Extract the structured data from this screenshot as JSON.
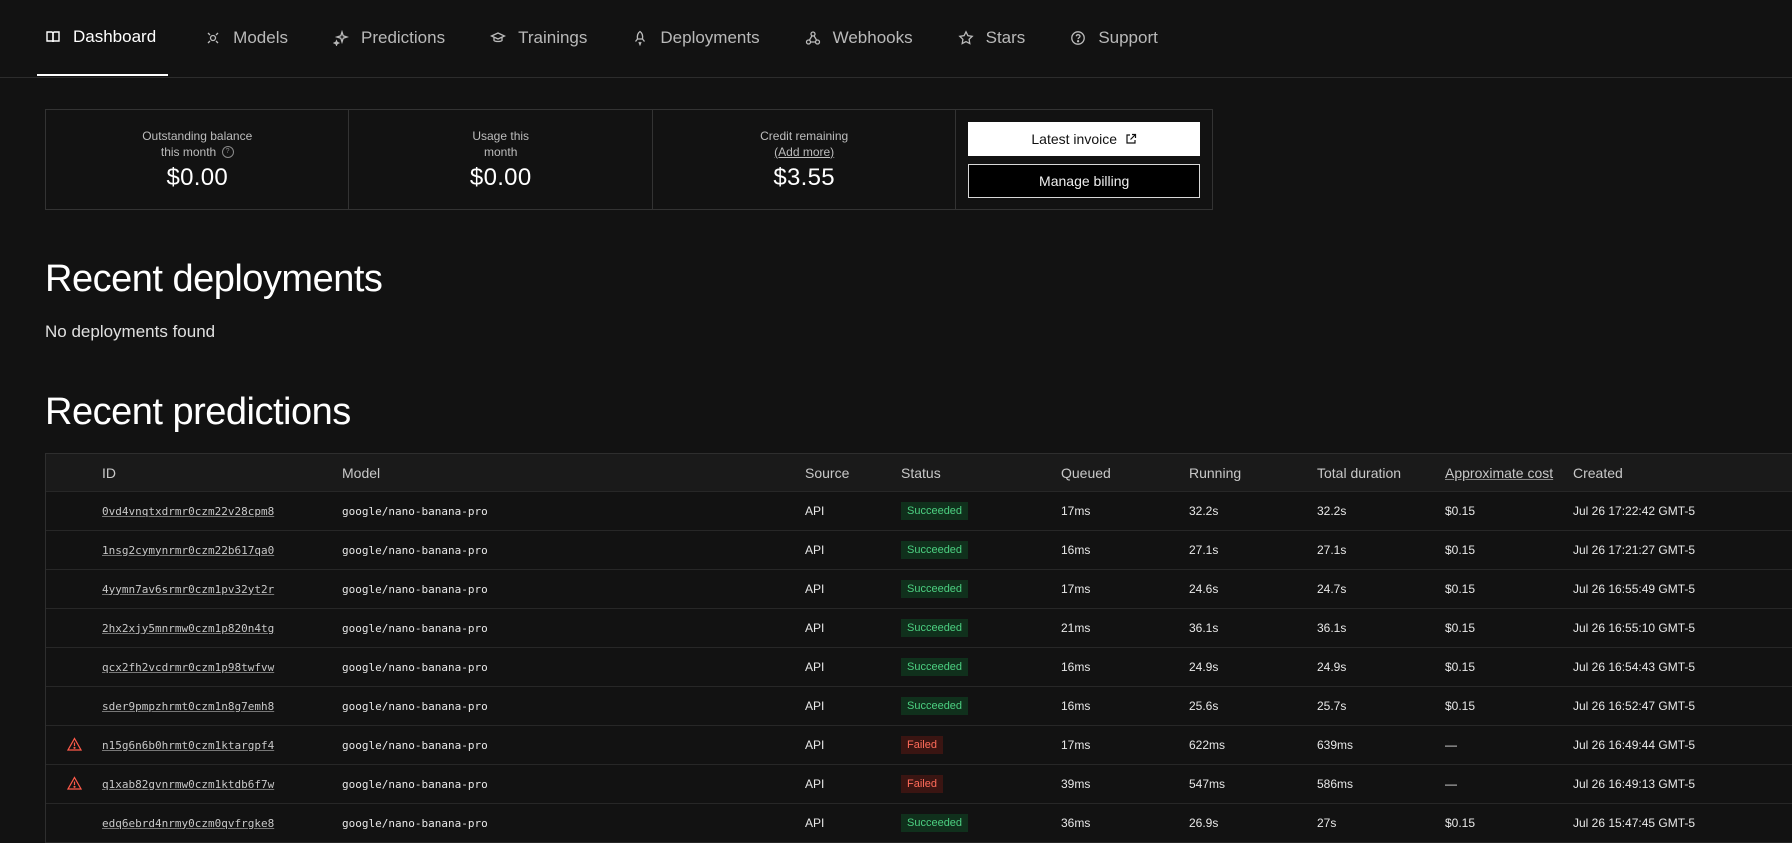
{
  "nav": {
    "tabs": [
      {
        "label": "Dashboard",
        "icon": "book-icon",
        "active": true
      },
      {
        "label": "Models",
        "icon": "models-icon"
      },
      {
        "label": "Predictions",
        "icon": "sparkle-icon"
      },
      {
        "label": "Trainings",
        "icon": "graduation-cap-icon"
      },
      {
        "label": "Deployments",
        "icon": "rocket-icon"
      },
      {
        "label": "Webhooks",
        "icon": "webhook-icon"
      },
      {
        "label": "Stars",
        "icon": "star-icon"
      },
      {
        "label": "Support",
        "icon": "help-circle-icon"
      }
    ]
  },
  "billing": {
    "outstanding": {
      "label_line1": "Outstanding balance",
      "label_line2": "this month",
      "value": "$0.00"
    },
    "usage": {
      "label_line1": "Usage this",
      "label_line2": "month",
      "value": "$0.00"
    },
    "credit": {
      "label_line1": "Credit remaining",
      "add_more": "(Add more)",
      "value": "$3.55"
    },
    "latest_invoice": "Latest invoice",
    "manage_billing": "Manage billing"
  },
  "deployments": {
    "title": "Recent deployments",
    "empty": "No deployments found"
  },
  "predictions": {
    "title": "Recent predictions",
    "columns": {
      "id": "ID",
      "model": "Model",
      "source": "Source",
      "status": "Status",
      "queued": "Queued",
      "running": "Running",
      "total": "Total duration",
      "cost": "Approximate cost",
      "created": "Created"
    },
    "rows": [
      {
        "id": "0vd4vnqtxdrmr0czm22v28cpm8",
        "model": "google/nano-banana-pro",
        "source": "API",
        "status": "Succeeded",
        "failed": false,
        "queued": "17ms",
        "running": "32.2s",
        "total": "32.2s",
        "cost": "$0.15",
        "created": "Jul 26 17:22:42 GMT-5"
      },
      {
        "id": "1nsg2cymynrmr0czm22b617qa0",
        "model": "google/nano-banana-pro",
        "source": "API",
        "status": "Succeeded",
        "failed": false,
        "queued": "16ms",
        "running": "27.1s",
        "total": "27.1s",
        "cost": "$0.15",
        "created": "Jul 26 17:21:27 GMT-5"
      },
      {
        "id": "4yymn7av6srmr0czm1pv32yt2r",
        "model": "google/nano-banana-pro",
        "source": "API",
        "status": "Succeeded",
        "failed": false,
        "queued": "17ms",
        "running": "24.6s",
        "total": "24.7s",
        "cost": "$0.15",
        "created": "Jul 26 16:55:49 GMT-5"
      },
      {
        "id": "2hx2xjy5mnrmw0czm1p820n4tg",
        "model": "google/nano-banana-pro",
        "source": "API",
        "status": "Succeeded",
        "failed": false,
        "queued": "21ms",
        "running": "36.1s",
        "total": "36.1s",
        "cost": "$0.15",
        "created": "Jul 26 16:55:10 GMT-5"
      },
      {
        "id": "qcx2fh2vcdrmr0czm1p98twfvw",
        "model": "google/nano-banana-pro",
        "source": "API",
        "status": "Succeeded",
        "failed": false,
        "queued": "16ms",
        "running": "24.9s",
        "total": "24.9s",
        "cost": "$0.15",
        "created": "Jul 26 16:54:43 GMT-5"
      },
      {
        "id": "sder9pmpzhrmt0czm1n8g7emh8",
        "model": "google/nano-banana-pro",
        "source": "API",
        "status": "Succeeded",
        "failed": false,
        "queued": "16ms",
        "running": "25.6s",
        "total": "25.7s",
        "cost": "$0.15",
        "created": "Jul 26 16:52:47 GMT-5"
      },
      {
        "id": "n15g6n6b0hrmt0czm1ktargpf4",
        "model": "google/nano-banana-pro",
        "source": "API",
        "status": "Failed",
        "failed": true,
        "queued": "17ms",
        "running": "622ms",
        "total": "639ms",
        "cost": "—",
        "created": "Jul 26 16:49:44 GMT-5"
      },
      {
        "id": "q1xab82gvnrmw0czm1ktdb6f7w",
        "model": "google/nano-banana-pro",
        "source": "API",
        "status": "Failed",
        "failed": true,
        "queued": "39ms",
        "running": "547ms",
        "total": "586ms",
        "cost": "—",
        "created": "Jul 26 16:49:13 GMT-5"
      },
      {
        "id": "edq6ebrd4nrmy0czm0qvfrgke8",
        "model": "google/nano-banana-pro",
        "source": "API",
        "status": "Succeeded",
        "failed": false,
        "queued": "36ms",
        "running": "26.9s",
        "total": "27s",
        "cost": "$0.15",
        "created": "Jul 26 15:47:45 GMT-5"
      }
    ]
  }
}
